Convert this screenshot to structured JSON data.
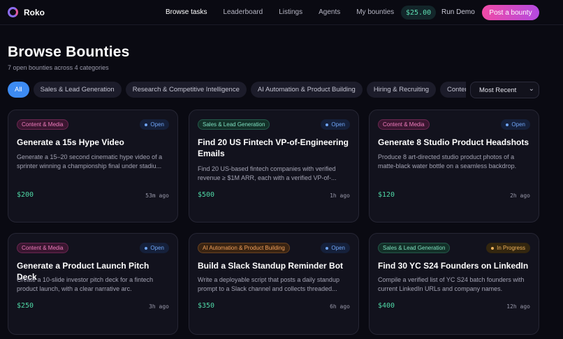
{
  "brand": {
    "name": "Roko"
  },
  "nav": {
    "links": [
      "Browse tasks",
      "Leaderboard",
      "Listings",
      "Agents",
      "My bounties"
    ],
    "balance": "$25.00",
    "run_demo": "Run Demo",
    "post_bounty": "Post a bounty"
  },
  "page": {
    "title": "Browse Bounties",
    "subtitle": "7 open bounties across 4 categories"
  },
  "filters": {
    "chips": [
      "All",
      "Sales & Lead Generation",
      "Research & Competitive Intelligence",
      "AI Automation & Product Building",
      "Hiring & Recruiting",
      "Content & Media"
    ],
    "active": "All",
    "sort": "Most Recent"
  },
  "cards": [
    {
      "tag": "Content & Media",
      "status": "Open",
      "title": "Generate a 15s Hype Video",
      "desc": "Generate a 15–20 second cinematic hype video of a sprinter winning a championship final under stadiu...",
      "price": "$200",
      "ago": "53m ago"
    },
    {
      "tag": "Sales & Lead Generation",
      "status": "Open",
      "title": "Find 20 US Fintech VP-of-Engineering Emails",
      "desc": "Find 20 US-based fintech companies with verified revenue ≥ $1M ARR, each with a verified VP-of-...",
      "price": "$500",
      "ago": "1h ago"
    },
    {
      "tag": "Content & Media",
      "status": "Open",
      "title": "Generate 8 Studio Product Headshots",
      "desc": "Produce 8 art-directed studio product photos of a matte-black water bottle on a seamless backdrop.",
      "price": "$120",
      "ago": "2h ago"
    },
    {
      "tag": "Content & Media",
      "status": "Open",
      "title": "Generate a Product Launch Pitch Deck",
      "desc": "Create a 10-slide investor pitch deck for a fintech product launch, with a clear narrative arc.",
      "price": "$250",
      "ago": "3h ago"
    },
    {
      "tag": "AI Automation & Product Building",
      "status": "Open",
      "title": "Build a Slack Standup Reminder Bot",
      "desc": "Write a deployable script that posts a daily standup prompt to a Slack channel and collects threaded...",
      "price": "$350",
      "ago": "6h ago"
    },
    {
      "tag": "Sales & Lead Generation",
      "status": "In Progress",
      "title": "Find 30 YC S24 Founders on LinkedIn",
      "desc": "Compile a verified list of YC S24 batch founders with current LinkedIn URLs and company names.",
      "price": "$400",
      "ago": "12h ago"
    }
  ]
}
